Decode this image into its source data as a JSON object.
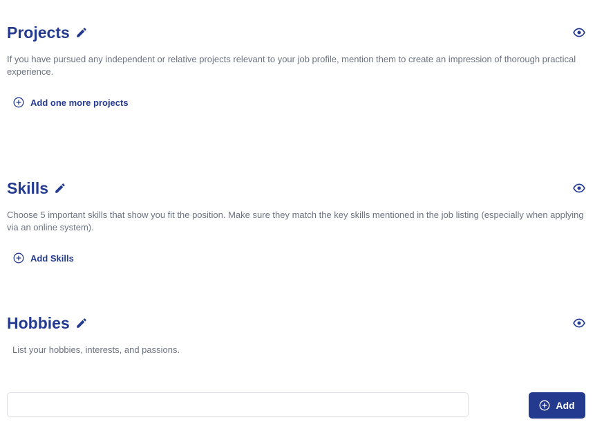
{
  "projects": {
    "title": "Projects",
    "description": "If you have pursued any independent or relative projects relevant to your job profile, mention them to create an impression of thorough practical experience.",
    "add_label": "Add one more projects"
  },
  "skills": {
    "title": "Skills",
    "description": "Choose 5 important skills that show you fit the position. Make sure they match the key skills mentioned in the job listing (especially when applying via an online system).",
    "add_label": "Add Skills"
  },
  "hobbies": {
    "title": "Hobbies",
    "description": "List your hobbies, interests, and passions.",
    "input_value": "",
    "input_placeholder": "",
    "add_button_label": "Add"
  },
  "icons": {
    "edit": "pencil-icon",
    "visibility": "eye-icon",
    "add": "plus-circle-icon"
  },
  "colors": {
    "accent": "#243a8f",
    "text_muted": "#6b7280",
    "input_border": "#dcdfe6"
  }
}
